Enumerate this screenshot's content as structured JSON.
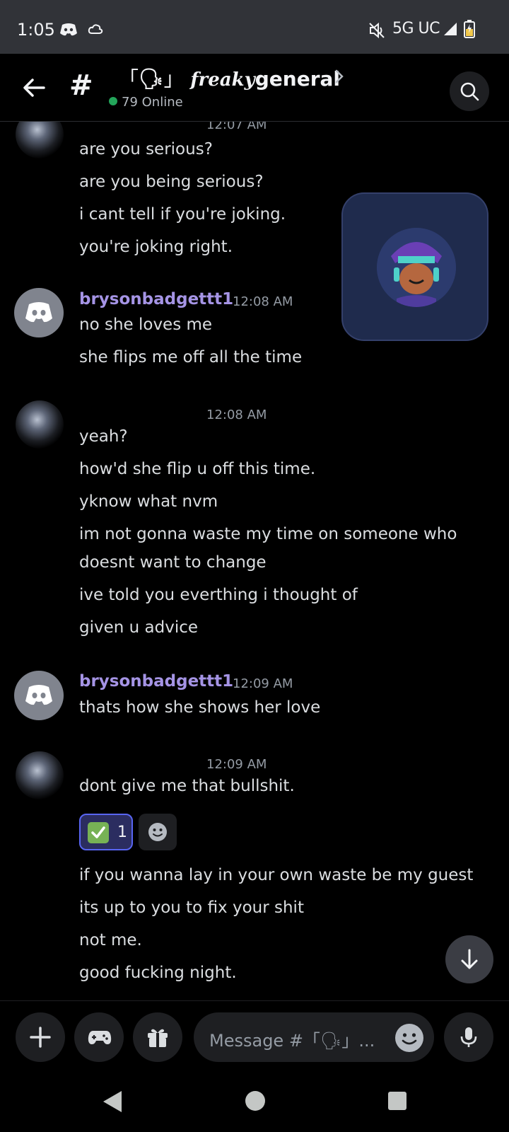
{
  "status_bar": {
    "time": "1:05",
    "network": "5G UC"
  },
  "header": {
    "channel_prefix": "「",
    "channel_emoji": "🗣",
    "channel_suffix": "」",
    "channel_script": "freaky",
    "channel_name": "general",
    "online_text": "79 Online"
  },
  "messages": {
    "group1": {
      "timestamp": "12:07 AM",
      "lines": [
        "are you serious?",
        "are you being serious?",
        "i cant tell if you're joking.",
        "you're joking right."
      ]
    },
    "group2": {
      "author": "brysonbadgettt1",
      "timestamp": "12:08 AM",
      "lines": [
        "no she loves me",
        "she flips me off all the time"
      ]
    },
    "group3": {
      "timestamp": "12:08 AM",
      "lines": [
        "yeah?",
        "how'd she flip u off this time.",
        "yknow what nvm",
        "im not gonna waste my time on someone who",
        "doesnt want to change",
        "ive told you everthing i thought of",
        "given u advice"
      ]
    },
    "group4": {
      "author": "brysonbadgettt1",
      "timestamp": "12:09 AM",
      "lines": [
        "thats how she shows her love"
      ]
    },
    "group5": {
      "timestamp": "12:09 AM",
      "lines": [
        "dont give me that bullshit.",
        "if you wanna lay in your own waste be my guest",
        "its up to you to fix your shit",
        "not me.",
        "good fucking night."
      ],
      "reaction": {
        "emoji": "✅",
        "count": "1"
      }
    }
  },
  "composer": {
    "placeholder": "Message #「🗣」..."
  },
  "icons": [
    "back-arrow-icon",
    "hash-icon",
    "search-icon",
    "plus-icon",
    "gamepad-icon",
    "gift-icon",
    "smile-icon",
    "mic-icon",
    "arrow-down-icon",
    "discord-logo-icon"
  ]
}
